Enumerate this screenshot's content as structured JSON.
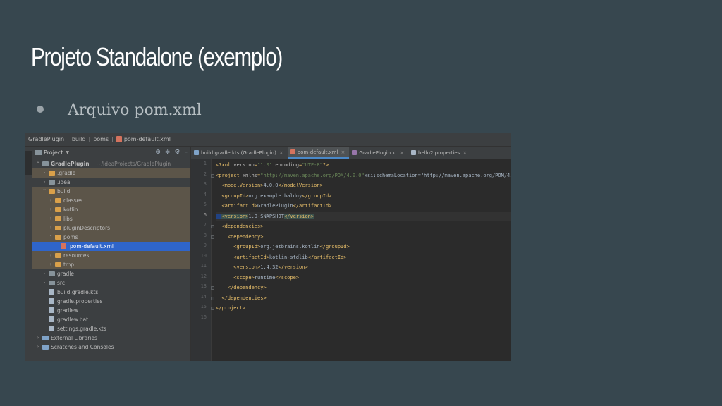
{
  "slide": {
    "title": "Projeto Standalone (exemplo)",
    "bullet": "Arquivo pom.xml"
  },
  "ide": {
    "breadcrumb": [
      "GradlePlugin",
      "build",
      "poms",
      "pom-default.xml"
    ],
    "side_strip_label": "1: Project",
    "panel": {
      "title": "Project",
      "dropdown_icon": "chevron-down-icon",
      "tools": [
        "target-icon",
        "collapse-icon",
        "gear-icon",
        "minimize-icon"
      ]
    },
    "tree": [
      {
        "depth": 0,
        "arrow": "down",
        "icon": "folder",
        "label": "GradlePlugin",
        "hint": "~/IdeaProjects/GradlePlugin",
        "bold": true
      },
      {
        "depth": 1,
        "arrow": "right",
        "icon": "folder-orange",
        "label": ".gradle",
        "excluded": true
      },
      {
        "depth": 1,
        "arrow": "right",
        "icon": "folder",
        "label": ".idea"
      },
      {
        "depth": 1,
        "arrow": "down",
        "icon": "folder-orange",
        "label": "build",
        "excluded": true
      },
      {
        "depth": 2,
        "arrow": "right",
        "icon": "folder-orange",
        "label": "classes",
        "excluded": true
      },
      {
        "depth": 2,
        "arrow": "right",
        "icon": "folder-orange",
        "label": "kotlin",
        "excluded": true
      },
      {
        "depth": 2,
        "arrow": "right",
        "icon": "folder-orange",
        "label": "libs",
        "excluded": true
      },
      {
        "depth": 2,
        "arrow": "right",
        "icon": "folder-orange",
        "label": "pluginDescriptors",
        "excluded": true
      },
      {
        "depth": 2,
        "arrow": "down",
        "icon": "folder-orange",
        "label": "poms",
        "excluded": true
      },
      {
        "depth": 3,
        "arrow": "",
        "icon": "xml",
        "label": "pom-default.xml",
        "selected": true
      },
      {
        "depth": 2,
        "arrow": "right",
        "icon": "folder-orange",
        "label": "resources",
        "excluded": true
      },
      {
        "depth": 2,
        "arrow": "right",
        "icon": "folder-orange",
        "label": "tmp",
        "excluded": true
      },
      {
        "depth": 1,
        "arrow": "right",
        "icon": "folder",
        "label": "gradle"
      },
      {
        "depth": 1,
        "arrow": "right",
        "icon": "folder",
        "label": "src"
      },
      {
        "depth": 1,
        "arrow": "",
        "icon": "file",
        "label": "build.gradle.kts"
      },
      {
        "depth": 1,
        "arrow": "",
        "icon": "file",
        "label": "gradle.properties"
      },
      {
        "depth": 1,
        "arrow": "",
        "icon": "file",
        "label": "gradlew"
      },
      {
        "depth": 1,
        "arrow": "",
        "icon": "file",
        "label": "gradlew.bat"
      },
      {
        "depth": 1,
        "arrow": "",
        "icon": "file",
        "label": "settings.gradle.kts"
      },
      {
        "depth": 0,
        "arrow": "right",
        "icon": "lib",
        "label": "External Libraries"
      },
      {
        "depth": 0,
        "arrow": "right",
        "icon": "lib",
        "label": "Scratches and Consoles"
      }
    ],
    "tabs": [
      {
        "label": "build.gradle.kts (GradlePlugin)",
        "color": "#7fa3c8",
        "active": false
      },
      {
        "label": "pom-default.xml",
        "color": "#d4735e",
        "active": true
      },
      {
        "label": "GradlePlugin.kt",
        "color": "#9876aa",
        "active": false
      },
      {
        "label": "hello2.properties",
        "color": "#a9b7c6",
        "active": false
      }
    ],
    "current_line": 6,
    "code": [
      "<?xml version=\"1.0\" encoding=\"UTF-8\"?>",
      "<project xmlns=\"http://maven.apache.org/POM/4.0.0\" xsi:schemaLocation=\"http://maven.apache.org/POM/4.0.0",
      "  <modelVersion>4.0.0</modelVersion>",
      "  <groupId>org.example.haldny</groupId>",
      "  <artifactId>GradlePlugin</artifactId>",
      "  <version>1.0-SNAPSHOT</version>",
      "  <dependencies>",
      "    <dependency>",
      "      <groupId>org.jetbrains.kotlin</groupId>",
      "      <artifactId>kotlin-stdlib</artifactId>",
      "      <version>1.4.32</version>",
      "      <scope>runtime</scope>",
      "    </dependency>",
      "  </dependencies>",
      "</project>",
      ""
    ]
  }
}
